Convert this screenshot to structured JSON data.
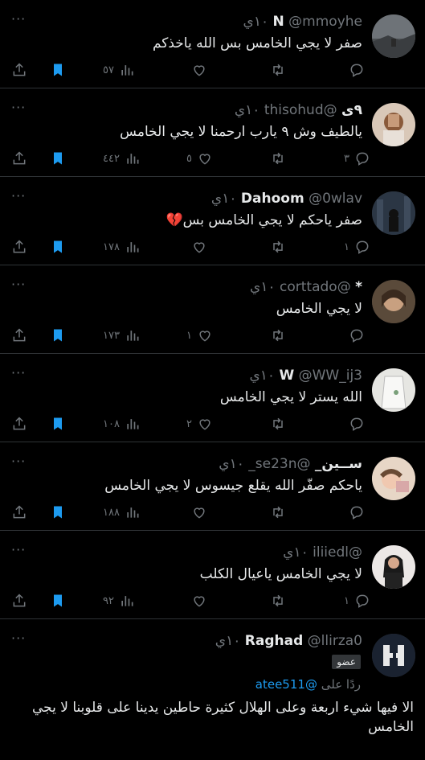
{
  "tweets": [
    {
      "name": "N",
      "handle": "@mmoyhe",
      "time": "١٠ي",
      "text": "صفر لا يجي الخامس بس الله ياخذكم",
      "replies": "",
      "retweets": "",
      "likes": "",
      "views": "٥٧"
    },
    {
      "name": "٩ﻯ",
      "handle": "@thisohud",
      "time": "١٠ي",
      "text": "يالطيف وش ٩ يارب ارحمنا لا يجي الخامس",
      "replies": "٣",
      "retweets": "",
      "likes": "٥",
      "views": "٤٤٢"
    },
    {
      "name": "Dahoom",
      "handle": "@0wlav",
      "time": "١٠ي",
      "text": "صفر ياحكم لا يجي الخامس بس💔",
      "replies": "١",
      "retweets": "",
      "likes": "",
      "views": "١٧٨"
    },
    {
      "name": "*",
      "handle": "@corttado",
      "time": "١٠ي",
      "text": "لا يجي الخامس",
      "replies": "",
      "retweets": "",
      "likes": "١",
      "views": "١٧٣"
    },
    {
      "name": "W",
      "handle": "@WW_ij3",
      "time": "١٠ي",
      "text": "الله يستر لا يجي الخامس",
      "replies": "",
      "retweets": "",
      "likes": "٢",
      "views": "١٠٨"
    },
    {
      "name": "ســين_",
      "handle": "@se23n_",
      "time": "١٠ي",
      "text": "ياحكم صفّر الله يقلع جيسوس لا يجي الخامس",
      "replies": "",
      "retweets": "",
      "likes": "",
      "views": "١٨٨"
    },
    {
      "name": "",
      "handle": "@iliiedl",
      "time": "١٠ي",
      "text": "لا يجي الخامس ياعيال الكلب",
      "replies": "١",
      "retweets": "",
      "likes": "",
      "views": "٩٢"
    }
  ],
  "last_tweet": {
    "name": "Raghad",
    "handle": "@llirza0",
    "time": "١٠ي",
    "badge": "عضو",
    "replying_prefix": "ردًا على ",
    "replying_to": "@atee511",
    "text": "الا فيها شيء اربعة وعلى الهلال كثيرة حاطين يدينا على قلوبنا لا يجي الخامس"
  },
  "icons": {
    "more": "more-icon",
    "reply": "reply-icon",
    "retweet": "retweet-icon",
    "like": "heart-icon",
    "views": "views-icon",
    "bookmark": "bookmark-icon",
    "share": "share-icon"
  },
  "colors": {
    "background": "#000000",
    "text": "#e7e9ea",
    "muted": "#71767b",
    "bookmark": "#1d9bf0",
    "link": "#1d9bf0"
  }
}
